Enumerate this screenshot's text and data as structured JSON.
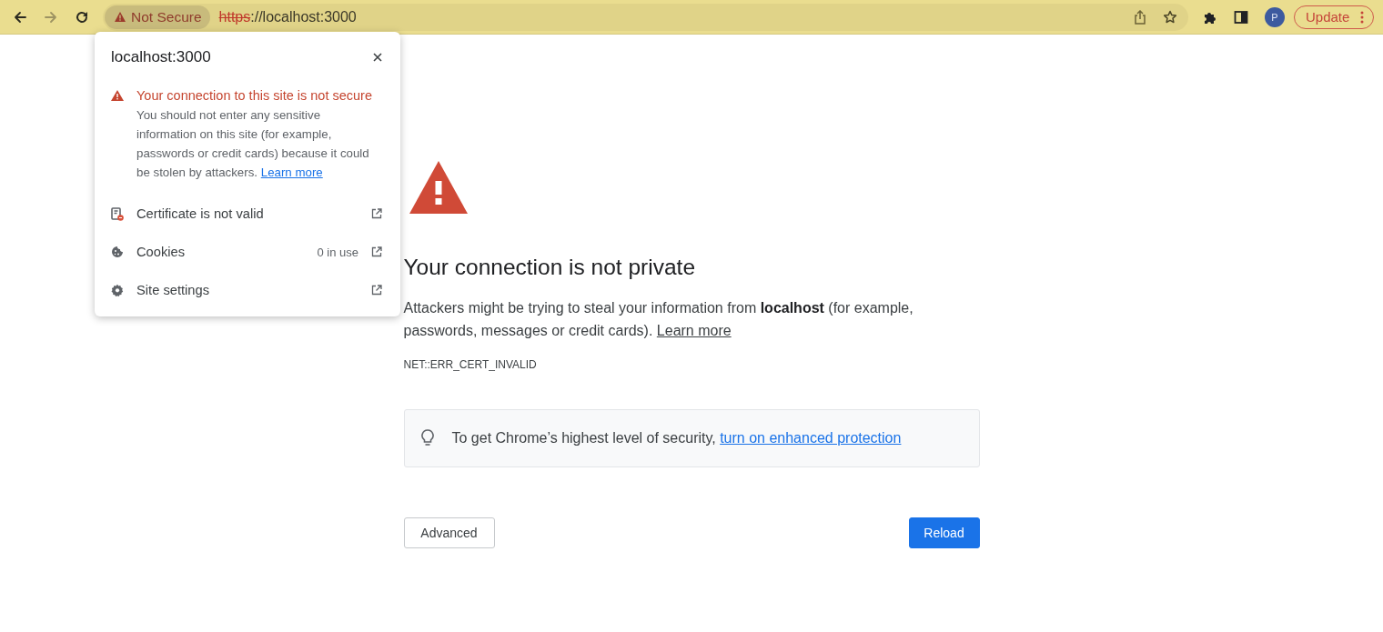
{
  "toolbar": {
    "nav_buttons": [
      {
        "kind": "back",
        "disabled": false
      },
      {
        "kind": "forward",
        "disabled": true
      },
      {
        "kind": "reload",
        "disabled": false
      }
    ],
    "security_chip": {
      "label": "Not Secure"
    },
    "url": {
      "scheme": "https",
      "rest": "://localhost:3000"
    },
    "avatar": {
      "letter": "P"
    },
    "update_button": {
      "label": "Update"
    }
  },
  "site_info_popup": {
    "title": "localhost:3000",
    "warning": {
      "heading": "Your connection to this site is not secure",
      "body": "You should not enter any sensitive information on this site (for example, passwords or credit cards) because it could be stolen by attackers.",
      "link": "Learn more"
    },
    "items": [
      {
        "kind": "certificate",
        "label": "Certificate is not valid"
      },
      {
        "kind": "cookies",
        "label": "Cookies",
        "detail": "0 in use"
      },
      {
        "kind": "settings",
        "label": "Site settings"
      }
    ]
  },
  "page": {
    "heading": "Your connection is not private",
    "description": "Attackers might be trying to steal your information from **localhost** (for example, passwords, messages or credit cards).",
    "link": "Learn more",
    "error_code": "NET::ERR_CERT_INVALID",
    "tip": {
      "text": "To get Chrome’s highest level of security,",
      "link": "turn on enhanced protection"
    },
    "buttons": [
      {
        "kind": "secondary",
        "label": "Advanced"
      },
      {
        "kind": "primary",
        "label": "Reload"
      }
    ]
  }
}
